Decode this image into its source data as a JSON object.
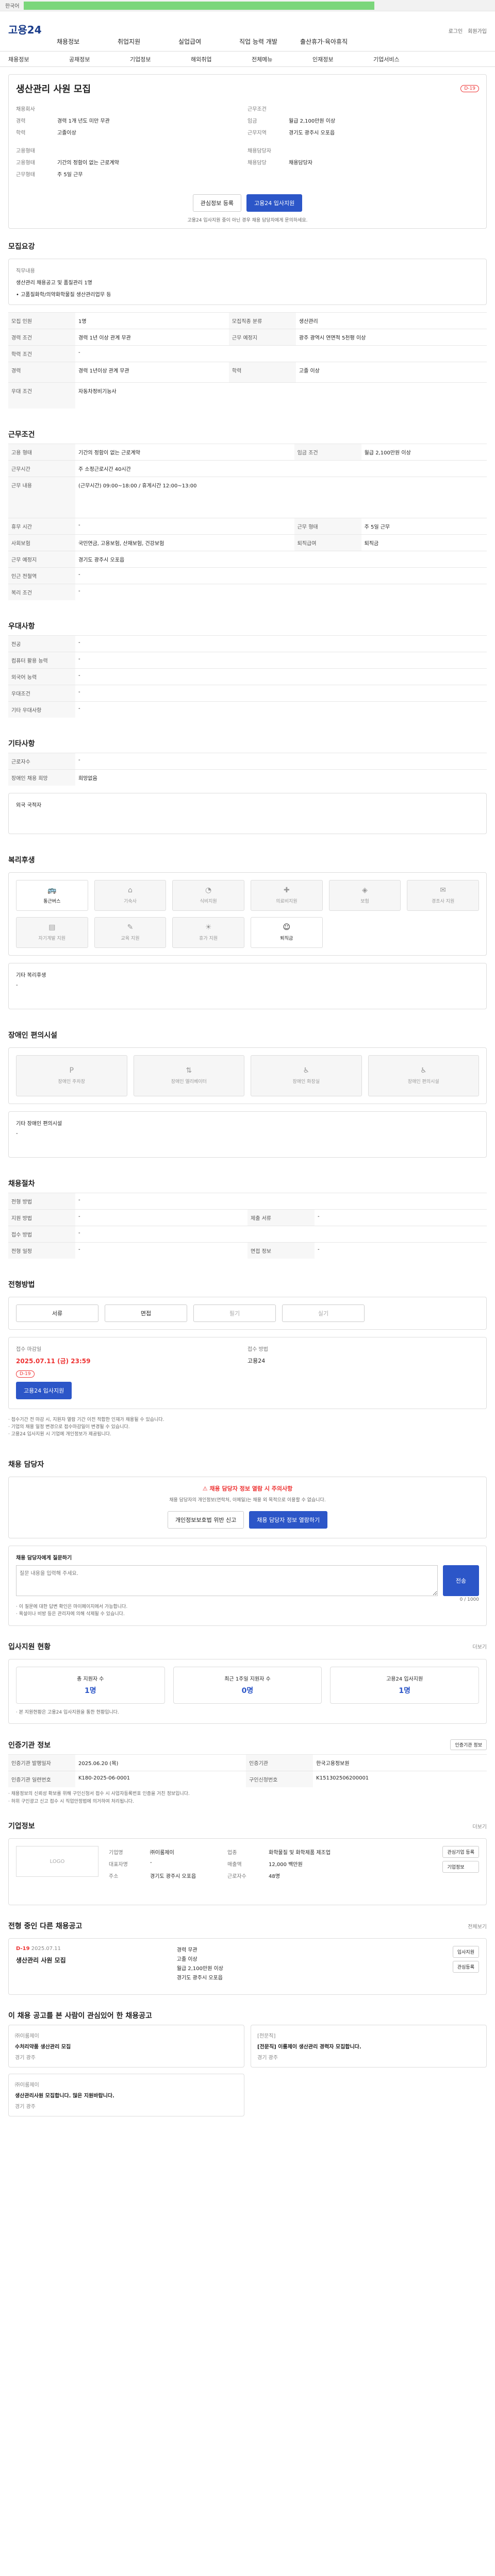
{
  "topbar": {
    "left": "한국어",
    "highlight": ""
  },
  "header": {
    "logo": "고용24",
    "menu": [
      "채용정보",
      "취업지원",
      "실업급여",
      "직업 능력 개발",
      "출산휴가·육아휴직"
    ],
    "util": [
      "로그인",
      "회원가입"
    ]
  },
  "subnav": [
    "채용정보",
    "공채정보",
    "기업정보",
    "해외취업",
    "전체메뉴",
    "인재정보",
    "기업서비스"
  ],
  "job": {
    "title": "생산관리 사원 모집",
    "deadline_badge": "D-19",
    "company_label": "채용회사",
    "left": [
      {
        "k": "경력",
        "v": "경력 1개 년도 미만 무관"
      },
      {
        "k": "학력",
        "v": "고졸이상"
      }
    ],
    "right_label": "근무조건",
    "right": [
      {
        "k": "임금",
        "v": "월급 2,100만원 이상"
      },
      {
        "k": "근무지역",
        "v": "경기도 광주시 오포읍"
      }
    ],
    "emp_label": "고용형태",
    "emp": [
      {
        "k": "고용형태",
        "v": "기간의 정함이 없는 근로계약"
      },
      {
        "k": "근무형태",
        "v": "주 5일 근무"
      }
    ],
    "contact_label": "채용담당자",
    "contact": [
      {
        "k": "채용담당",
        "v": "채용담당자"
      }
    ],
    "btn_interest": "관심정보 등록",
    "btn_apply": "고용24 입사지원",
    "notice": "고용24 입사지원 중이 아닌 경우 채용 담당자에게 문의하세요."
  },
  "section_recruit": {
    "title": "모집요강",
    "job_title_label": "직무내용",
    "job_desc": "생산관리 채용공고 및 품질관리 1명",
    "job_desc2": "• 고품질화학/의약화학물질 생산관리업무 등",
    "rows": [
      {
        "k": "모집 인원",
        "v": "1명",
        "k2": "모집직종 분류",
        "v2": "생산관리"
      },
      {
        "k": "경력 조건",
        "v": "경력 1년 이상 관계 무관",
        "k2": "근무 예정지",
        "v2": "광주 광역시 연면적 5천평 이상"
      },
      {
        "k": "학력 조건",
        "v": "-",
        "k2": "",
        "v2": ""
      },
      {
        "k": "경력",
        "v": "경력 1년이상 관계 무관",
        "k2": "학력",
        "v2": "고졸 이상"
      },
      {
        "k": "우대 조건",
        "v": "자동차정비기능사",
        "k2": "",
        "v2": ""
      }
    ]
  },
  "section_cond": {
    "title": "근무조건",
    "rows": [
      {
        "k": "고용 형태",
        "v": "기간의 정함이 없는 근로계약",
        "k2": "임금 조건",
        "v2": "월급 2,100만원 이상"
      },
      {
        "k": "근무시간",
        "v": "주 소정근로시간 40시간",
        "k2": "",
        "v2": ""
      },
      {
        "k": "근무 내용",
        "v": "(근무시간) 09:00~18:00 / 휴게시간 12:00~13:00",
        "k2": "",
        "v2": ""
      },
      {
        "k": "휴무 시간",
        "v": "-",
        "k2": "근무 형태",
        "v2": "주 5일 근무"
      },
      {
        "k": "사회보험",
        "v": "국민연금, 고용보험, 산재보험, 건강보험",
        "k2": "퇴직급여",
        "v2": "퇴직금"
      },
      {
        "k": "근무 예정지",
        "v": "경기도 광주시 오포읍",
        "k2": "",
        "v2": ""
      },
      {
        "k": "인근 전철역",
        "v": "-",
        "k2": "",
        "v2": ""
      },
      {
        "k": "복리 조건",
        "v": "-",
        "k2": "",
        "v2": ""
      }
    ]
  },
  "section_pref": {
    "title": "우대사항",
    "rows": [
      {
        "k": "전공",
        "v": "-"
      },
      {
        "k": "컴퓨터 활용 능력",
        "v": "-"
      },
      {
        "k": "외국어 능력",
        "v": "-"
      },
      {
        "k": "우대조건",
        "v": "-"
      },
      {
        "k": "기타 우대사항",
        "v": "-"
      }
    ]
  },
  "section_etc": {
    "title": "기타사항",
    "rows": [
      {
        "k": "근로자수",
        "v": "-"
      },
      {
        "k": "장애인 채용 희망",
        "v": "희망없음"
      }
    ],
    "box_label": "외국 국적자"
  },
  "section_welfare": {
    "title": "복리후생",
    "tiles": [
      "통근버스",
      "기숙사",
      "식비지원",
      "의료비지원",
      "보험",
      "경조사 지원",
      "자기계발 지원",
      "교육 지원",
      "휴가 지원",
      "퇴직금"
    ],
    "etc_label": "기타 복리후생",
    "etc_value": "-"
  },
  "section_barrier": {
    "title": "장애인 편의시설",
    "tiles": [
      "장애인 주차장",
      "장애인 엘리베이터",
      "장애인 화장실",
      "장애인 편의시설"
    ],
    "etc_label": "기타 장애인 편의시설",
    "etc_value": "-"
  },
  "section_process": {
    "title": "채용절차",
    "rows": [
      {
        "k": "전형 방법",
        "v": "-",
        "k2": "",
        "v2": ""
      },
      {
        "k": "지원 방법",
        "v": "-",
        "k2": "제출 서류",
        "v2": "-"
      },
      {
        "k": "접수 방법",
        "v": "-",
        "k2": "",
        "v2": ""
      },
      {
        "k": "전형 일정",
        "v": "-",
        "k2": "면접 정보",
        "v2": "-"
      }
    ]
  },
  "section_apply_method": {
    "title": "전형방법",
    "buttons": [
      "서류",
      "면접",
      "필기",
      "실기"
    ]
  },
  "section_deadline": {
    "label": "접수 마감일",
    "value": "2025.07.11 (금) 23:59",
    "badge": "D-19",
    "apply_btn": "고용24 입사지원",
    "method_label": "접수 방법",
    "method_value": "고용24"
  },
  "warnings": [
    "· 접수기간 전 마감 시, 지원자 열람 기간 이전 적합한 인재가 채용될 수 있습니다.",
    "· 기업의 채용 일정 변경으로 접수마감일이 변경될 수 있습니다.",
    "· 고용24 입사지원 시 기업에 개인정보가 제공됩니다."
  ],
  "section_contact": {
    "title": "채용 담당자",
    "alert": "채용 담당자 정보 열람 시 주의사항",
    "alert_desc": "채용 담당자의 개인정보(연락처, 이메일)는 채용 외 목적으로 이용할 수 없습니다.",
    "btn_left": "개인정보보호법 위반 신고",
    "btn_right": "채용 담당자 정보 열람하기"
  },
  "section_question": {
    "label": "채용 담당자에게 질문하기",
    "placeholder": "질문 내용을 입력해 주세요.",
    "count": "0 / 1000",
    "submit": "전송",
    "notes": [
      "· 이 질문에 대한 답변 확인은 마이페이지에서 가능합니다.",
      "· 욕설이나 비방 등은 관리자에 의해 삭제될 수 있습니다."
    ]
  },
  "section_stats": {
    "title": "입사지원 현황",
    "link": "더보기",
    "stats": [
      {
        "label": "총 지원자 수",
        "value": "1명"
      },
      {
        "label": "최근 1주일 지원자 수",
        "value": "0명"
      },
      {
        "label": "고용24 입사지원",
        "value": "1명"
      }
    ],
    "note": "· 본 지원현황은 고용24 입사지원을 통한 현황입니다."
  },
  "section_org": {
    "title": "인증기관 정보",
    "link": "인증기관 정보",
    "rows": [
      {
        "k": "인증기관 발행일자",
        "v": "2025.06.20 (목)",
        "k2": "인증기관",
        "v2": "한국고용정보원"
      },
      {
        "k": "인증기관 일련번호",
        "v": "K180-2025-06-0001",
        "k2": "구인신청번호",
        "v2": "K151302506200001"
      }
    ],
    "notes": [
      "· 채용정보의 신뢰성 확보를 위해 구인신청서 접수 시 사업자등록번호 인증을 거친 정보입니다.",
      "· 허위 구인광고 신고 접수 시 직업안정법에 의거하여 처리됩니다."
    ]
  },
  "section_company": {
    "title": "기업정보",
    "link": "더보기",
    "logo_label": "LOGO",
    "rows": [
      {
        "k": "기업명",
        "v": "㈜이룸제이",
        "k2": "업종",
        "v2": "화학물질 및 화학제품 제조업"
      },
      {
        "k": "대표자명",
        "v": "-",
        "k2": "매출액",
        "v2": "12,000 백만원"
      },
      {
        "k": "주소",
        "v": "경기도 광주시 오포읍",
        "k2": "근로자수",
        "v2": "48명"
      }
    ],
    "btns": [
      "관심기업 등록",
      "기업정보"
    ]
  },
  "section_similar": {
    "title": "전형 중인 다른 채용공고",
    "link": "전체보기",
    "item": {
      "dday": "D-19",
      "date": "2025.07.11",
      "title": "생산관리 사원 모집",
      "tags": [
        "경력 무관",
        "고졸 이상",
        "월급 2,100만원 이상",
        "경기도 광주시 오포읍"
      ]
    },
    "btns": [
      "입사지원",
      "관심등록"
    ]
  },
  "section_recommend": {
    "title": "이 채용 공고를 본 사람이 관심있어 한 채용공고",
    "cards": [
      {
        "company": "㈜이룸제이",
        "title": "수처리약품 생산관리 모집",
        "tag": "경기 광주"
      },
      {
        "company": "[전문직]",
        "title": "[전문직] 이룸제이 생산관리 경력자 모집합니다.",
        "tag": "경기 광주"
      },
      {
        "company": "㈜이룸제이",
        "title": "생산관리사원 모집합니다. 많은 지원바랍니다.",
        "tag": "경기 광주"
      }
    ]
  }
}
